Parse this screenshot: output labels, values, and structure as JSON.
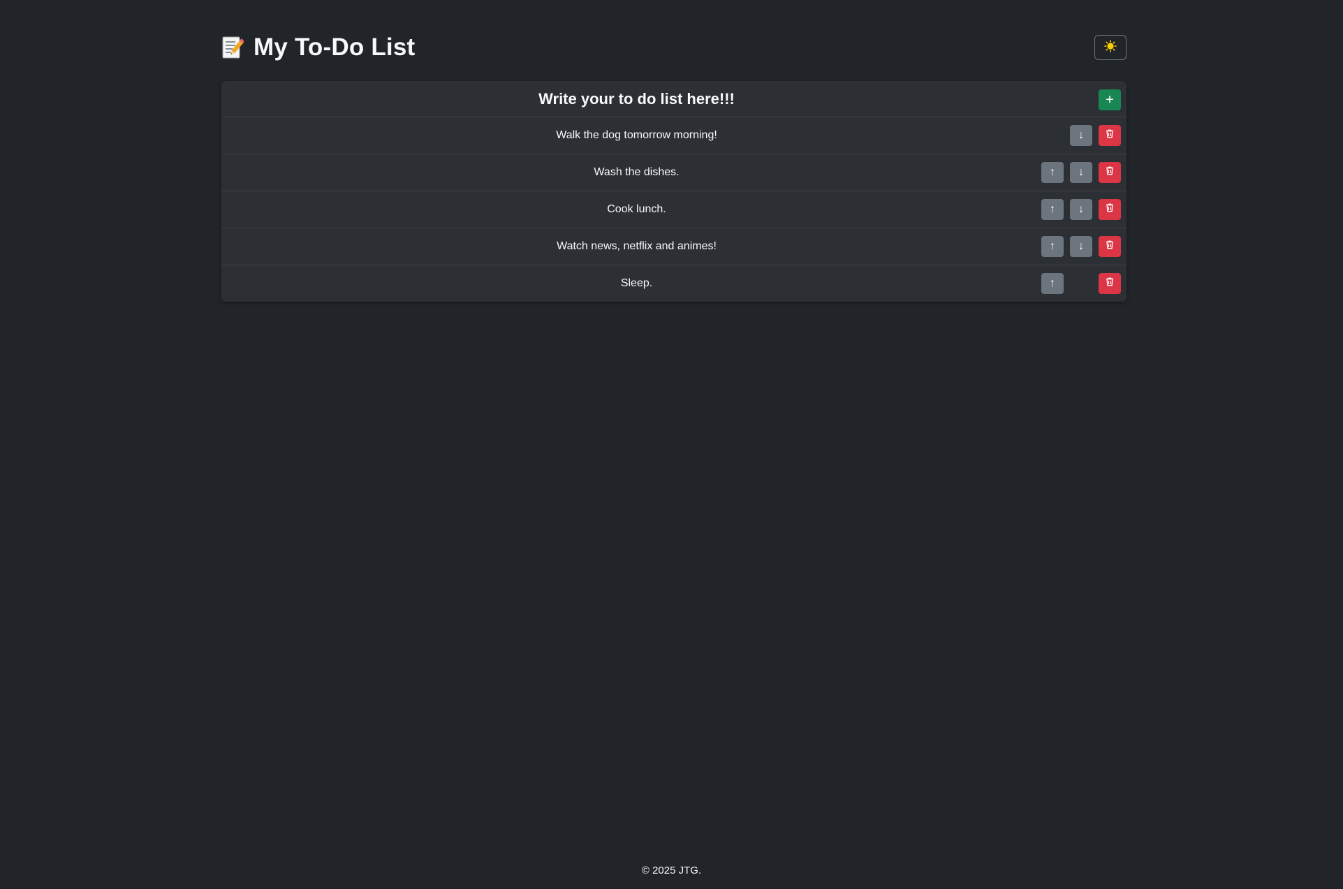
{
  "app": {
    "title": "My To-Do List",
    "title_icon": "memo-icon",
    "theme_toggle_icon": "sun-icon"
  },
  "panel": {
    "header_title": "Write your to do list here!!!",
    "add_button_label": "+"
  },
  "items": [
    {
      "text": "Walk the dog tomorrow morning!",
      "can_move_up": false,
      "can_move_down": true
    },
    {
      "text": "Wash the dishes.",
      "can_move_up": true,
      "can_move_down": true
    },
    {
      "text": "Cook lunch.",
      "can_move_up": true,
      "can_move_down": true
    },
    {
      "text": "Watch news, netflix and animes!",
      "can_move_up": true,
      "can_move_down": true
    },
    {
      "text": "Sleep.",
      "can_move_up": true,
      "can_move_down": false
    }
  ],
  "icons": {
    "move_up": "↑",
    "move_down": "↓"
  },
  "footer": {
    "text": "© 2025 JTG."
  },
  "colors": {
    "background": "#212529",
    "panel": "#2c3034",
    "add_button": "#198754",
    "move_button": "#6c757d",
    "delete_button": "#dc3545",
    "sun": "#ffcc00"
  }
}
